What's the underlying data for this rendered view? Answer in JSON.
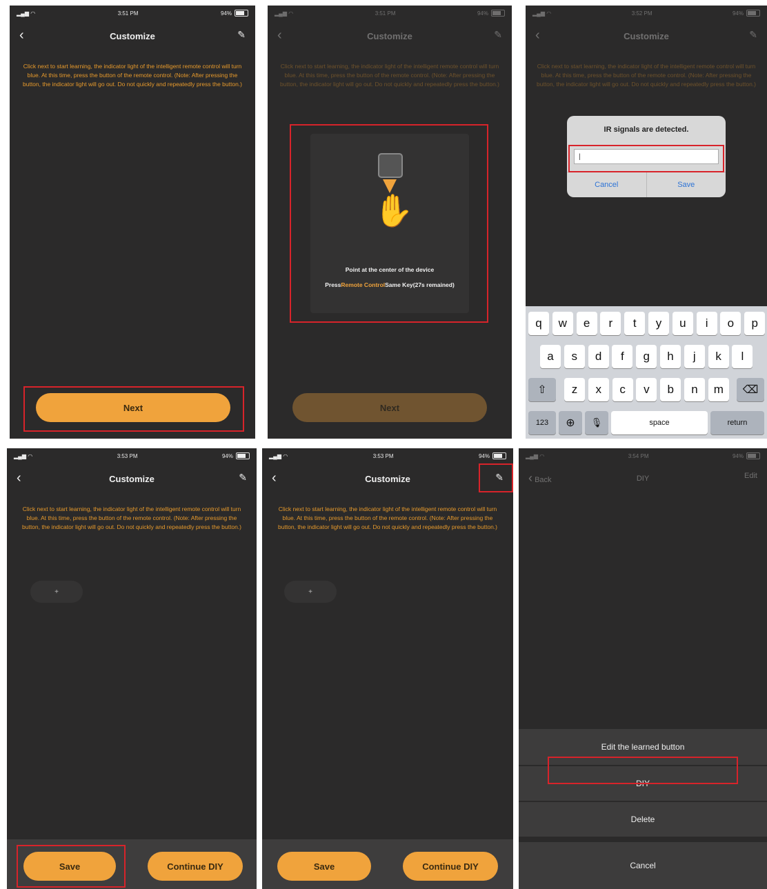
{
  "status": {
    "time_1": "3:51 PM",
    "time_2": "3:52 PM",
    "time_3": "3:53 PM",
    "time_4": "3:54 PM",
    "battery": "94%"
  },
  "nav": {
    "back_glyph": "‹",
    "edit_glyph": "✎",
    "title_customize": "Customize",
    "title_diy": "DIY",
    "back_label": "Back",
    "edit_label": "Edit"
  },
  "instructions": "Click next to start learning, the indicator light of the intelligent remote control will turn blue. At this time, press the button of the remote control. (Note: After pressing the button, the indicator light will go out. Do not quickly and repeatedly press the button.)",
  "buttons": {
    "next": "Next",
    "save": "Save",
    "continue_diy": "Continue DIY"
  },
  "learning": {
    "line1": "Point at the center of the device",
    "line2_prefix": "Press",
    "line2_highlight": "Remote Control",
    "line2_suffix": "Same Key(27s remained)"
  },
  "dialog": {
    "title": "IR signals are detected.",
    "input_value": "|",
    "cancel": "Cancel",
    "save": "Save"
  },
  "keyboard": {
    "row1": [
      "q",
      "w",
      "e",
      "r",
      "t",
      "y",
      "u",
      "i",
      "o",
      "p"
    ],
    "row2": [
      "a",
      "s",
      "d",
      "f",
      "g",
      "h",
      "j",
      "k",
      "l"
    ],
    "row3": [
      "z",
      "x",
      "c",
      "v",
      "b",
      "n",
      "m"
    ],
    "shift": "⇧",
    "backspace": "⌫",
    "numbers": "123",
    "globe": "⊕",
    "mic": "🎙",
    "space": "space",
    "return": "return"
  },
  "learned_button": "+",
  "sheet": {
    "edit": "Edit the learned button",
    "diy": "DIY",
    "delete": "Delete",
    "cancel": "Cancel"
  },
  "colors": {
    "accent": "#f0a33c",
    "highlight_box": "#d8232a",
    "background": "#2b2a2a"
  }
}
